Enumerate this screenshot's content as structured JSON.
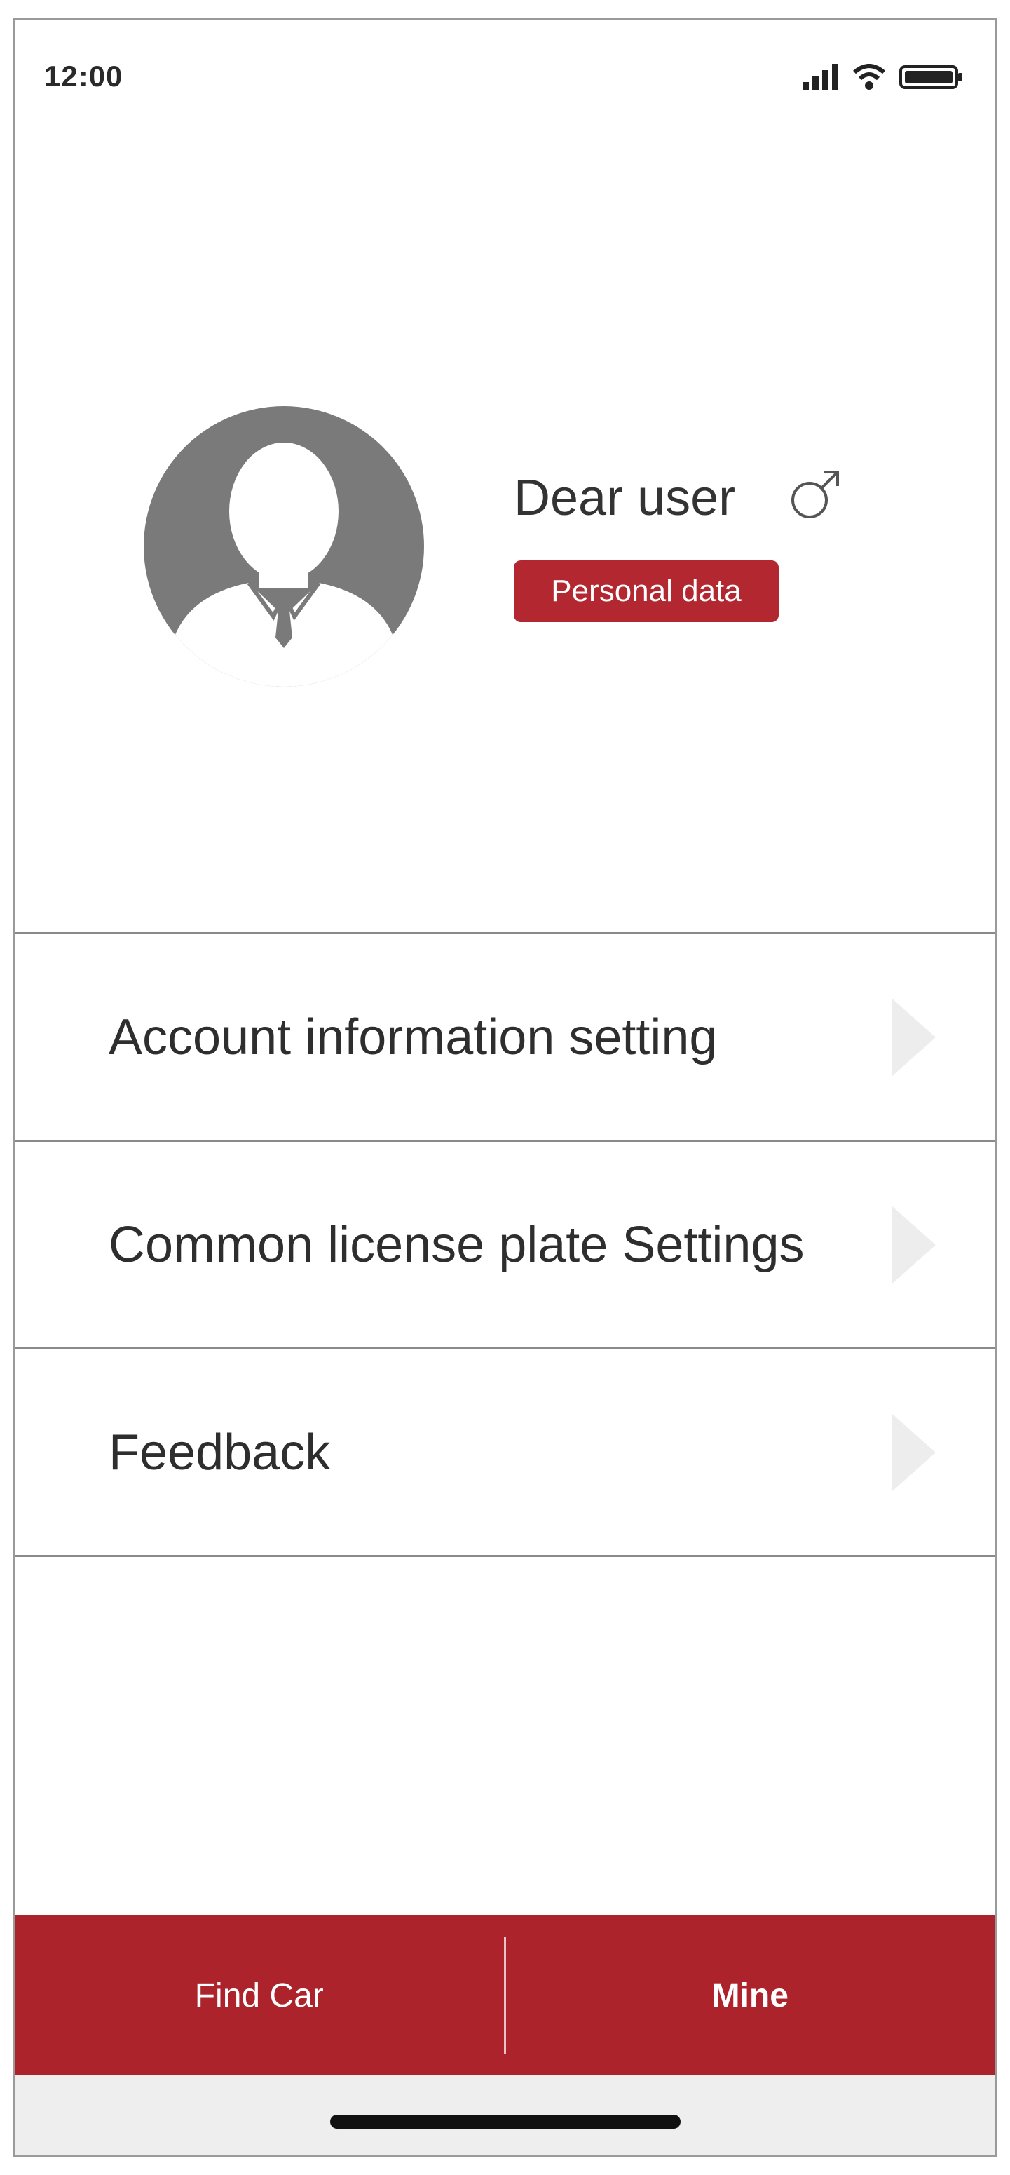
{
  "status_bar": {
    "time": "12:00",
    "icons": [
      "signal-icon",
      "wifi-icon",
      "battery-icon"
    ]
  },
  "profile": {
    "avatar_icon": "person-avatar-icon",
    "name": "Dear user",
    "gender_symbol": "♂",
    "gender_icon": "male-gender-icon",
    "personal_data_label": "Personal data",
    "badge_color": "#b22730"
  },
  "menu": {
    "items": [
      {
        "label": "Account information setting",
        "icon": "chevron-right-icon"
      },
      {
        "label": "Common license plate Settings",
        "icon": "chevron-right-icon"
      },
      {
        "label": "Feedback",
        "icon": "chevron-right-icon"
      }
    ]
  },
  "tab_bar": {
    "background": "#ad232c",
    "tabs": [
      {
        "label": "Find Car",
        "active": false
      },
      {
        "label": "Mine",
        "active": true
      }
    ]
  }
}
